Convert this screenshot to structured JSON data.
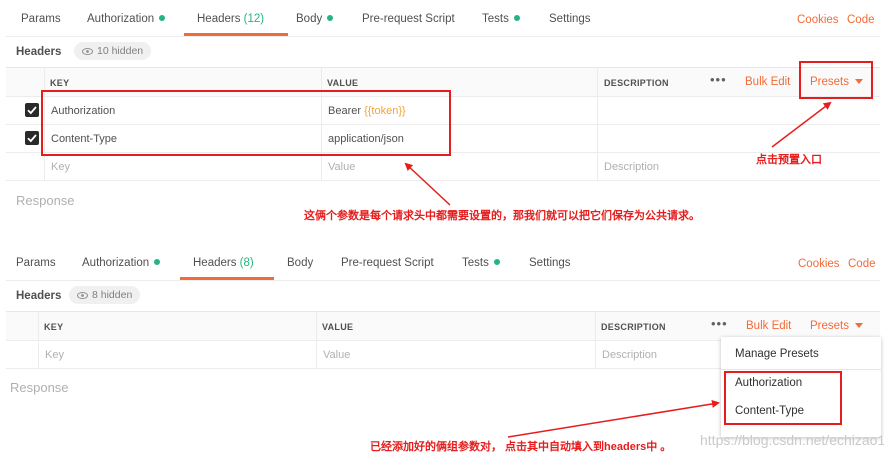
{
  "top": {
    "tabs": [
      {
        "label": "Params"
      },
      {
        "label": "Authorization"
      },
      {
        "label": "Headers",
        "count": "(12)"
      },
      {
        "label": "Body"
      },
      {
        "label": "Pre-request Script"
      },
      {
        "label": "Tests"
      },
      {
        "label": "Settings"
      }
    ],
    "cookies": "Cookies",
    "code": "Code",
    "section_title": "Headers",
    "hidden_label": "10 hidden",
    "columns": {
      "key": "KEY",
      "value": "VALUE",
      "description": "DESCRIPTION"
    },
    "bulk_edit": "Bulk Edit",
    "presets": "Presets",
    "rows": [
      {
        "key": "Authorization",
        "value_prefix": "Bearer ",
        "value_token": "{{token}}"
      },
      {
        "key": "Content-Type",
        "value_prefix": "application/json",
        "value_token": ""
      }
    ],
    "placeholders": {
      "key": "Key",
      "value": "Value",
      "description": "Description"
    },
    "response": "Response"
  },
  "bottom": {
    "tabs": [
      {
        "label": "Params"
      },
      {
        "label": "Authorization"
      },
      {
        "label": "Headers",
        "count": "(8)"
      },
      {
        "label": "Body"
      },
      {
        "label": "Pre-request Script"
      },
      {
        "label": "Tests"
      },
      {
        "label": "Settings"
      }
    ],
    "cookies": "Cookies",
    "code": "Code",
    "section_title": "Headers",
    "hidden_label": "8 hidden",
    "columns": {
      "key": "KEY",
      "value": "VALUE",
      "description": "DESCRIPTION"
    },
    "bulk_edit": "Bulk Edit",
    "presets": "Presets",
    "placeholders": {
      "key": "Key",
      "value": "Value",
      "description": "Description"
    },
    "response": "Response",
    "dropdown": {
      "manage": "Manage Presets",
      "items": [
        "Authorization",
        "Content-Type"
      ]
    }
  },
  "annotations": {
    "click_presets": "点击预置入口",
    "params_note": "这俩个参数是每个请求头中都需要设置的，那我们就可以把它们保存为公共请求。",
    "added_note": "已经添加好的俩组参数对， 点击其中自动填入到headers中 。"
  },
  "watermark": "https://blog.csdn.net/echizao1839",
  "colors": {
    "accent": "#f26b3a",
    "green": "#26b47f",
    "annotation": "#e51d1d",
    "token": "#f2a33a"
  }
}
